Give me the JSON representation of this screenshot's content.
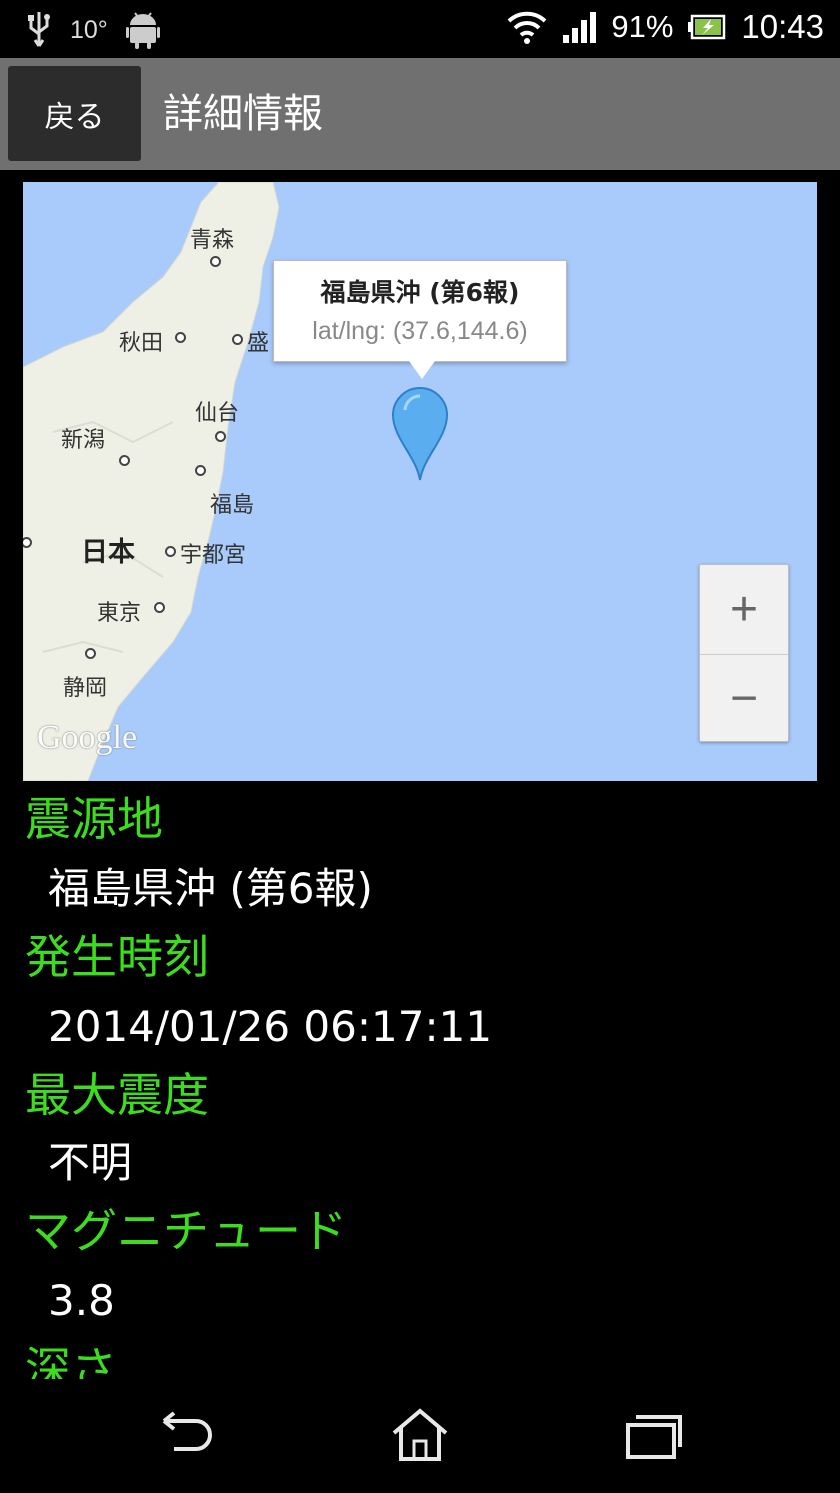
{
  "status_bar": {
    "temperature": "10°",
    "battery": "91%",
    "time": "10:43",
    "icons": [
      "usb-icon",
      "android-debug-icon",
      "wifi-icon",
      "signal-icon",
      "battery-charging-icon"
    ]
  },
  "action_bar": {
    "back_label": "戻る",
    "title": "詳細情報"
  },
  "map": {
    "info_title": "福島県沖 (第6報)",
    "info_coords": "lat/lng: (37.6,144.6)",
    "cities": {
      "aomori": "青森",
      "akita": "秋田",
      "morioka": "盛",
      "sendai": "仙台",
      "niigata": "新潟",
      "fukushima": "福島",
      "utsunomiya": "宇都宮",
      "tokyo": "東京",
      "shizuoka": "静岡"
    },
    "country": "日本",
    "zoom_in": "+",
    "zoom_out": "−",
    "logo": "Google",
    "ocean_color": "#a8cbfb",
    "marker_color": "#5aaef0"
  },
  "details": {
    "epicenter_label": "震源地",
    "epicenter_value": "福島県沖 (第6報)",
    "time_label": "発生時刻",
    "time_value": "2014/01/26 06:17:11",
    "intensity_label": "最大震度",
    "intensity_value": "不明",
    "magnitude_label": "マグニチュード",
    "magnitude_value": "3.8",
    "depth_label": "深さ",
    "label_color": "#3ddc1e"
  },
  "nav_bar": {
    "icons": [
      "back-icon",
      "home-icon",
      "recent-apps-icon"
    ]
  }
}
